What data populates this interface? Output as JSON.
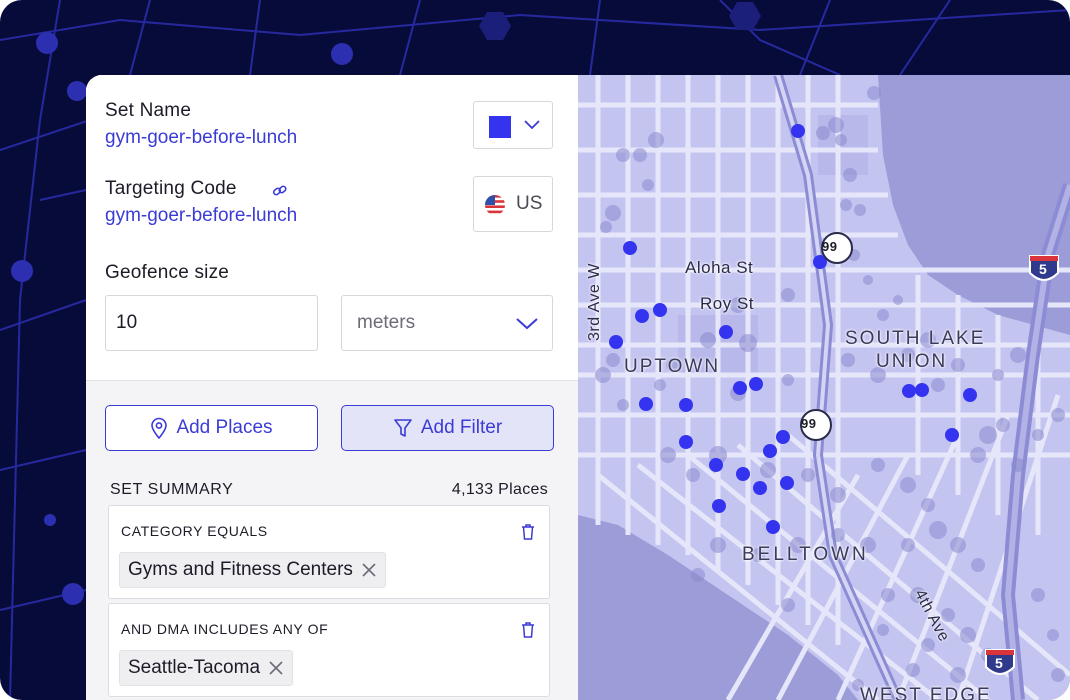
{
  "panel": {
    "set_name_label": "Set Name",
    "set_name_value": "gym-goer-before-lunch",
    "targeting_label": "Targeting Code",
    "targeting_value": "gym-goer-before-lunch",
    "country": "US",
    "geofence_label": "Geofence size",
    "geofence_value": "10",
    "unit_selected": "meters",
    "add_places_label": "Add Places",
    "add_filter_label": "Add Filter",
    "summary_title": "SET SUMMARY",
    "summary_count": "4,133 Places",
    "filters": [
      {
        "title": "CATEGORY EQUALS",
        "chip": "Gyms and Fitness Centers"
      },
      {
        "title": "AND DMA INCLUDES ANY OF",
        "chip": "Seattle-Tacoma"
      }
    ],
    "swatch_color": "#3434f0"
  },
  "map": {
    "labels": {
      "aloha": "Aloha St",
      "roy": "Roy St",
      "third_ave": "3rd Ave W",
      "uptown": "UPTOWN",
      "south_lake": "SOUTH LAKE",
      "union": "UNION",
      "belltown": "BELLTOWN",
      "fourth_ave": "4th Ave",
      "west_edge": "WEST EDGE"
    },
    "shields": {
      "sr99_a": "99",
      "sr99_b": "99",
      "i5_a": "5",
      "i5_b": "5"
    },
    "accent": "#3434f0"
  }
}
